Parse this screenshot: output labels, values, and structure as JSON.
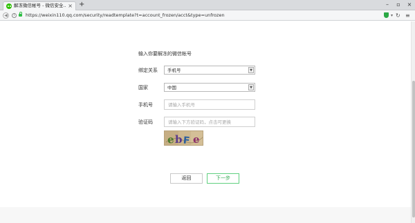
{
  "browser": {
    "tab_title": "解冻微信帐号 - 微信安全...",
    "tab_close": "×",
    "new_tab": "+",
    "window_controls": {
      "minimize": "–",
      "maximize": "▫",
      "close": "×"
    },
    "url": "https://weixin110.qq.com/security/readtemplate?t=account_frozen/acct&type=unfrozen",
    "icons": [
      "back-icon",
      "info-icon",
      "lock-icon",
      "shield-icon",
      "dropdown-icon",
      "reload-icon",
      "menu-icon"
    ]
  },
  "form": {
    "title": "输入你要解冻的微信帐号",
    "relation": {
      "label": "绑定关系",
      "value": "手机号"
    },
    "country": {
      "label": "国家",
      "value": "中国"
    },
    "phone": {
      "label": "手机号",
      "placeholder": "请输入手机号"
    },
    "captcha": {
      "label": "验证码",
      "placeholder": "请输入下方验证码，点击可更换",
      "image_text": "ebFe"
    }
  },
  "buttons": {
    "back": "返回",
    "next": "下一步"
  },
  "colors": {
    "accent_green": "#2fa84f",
    "tab_bar": "#d9dbde"
  }
}
